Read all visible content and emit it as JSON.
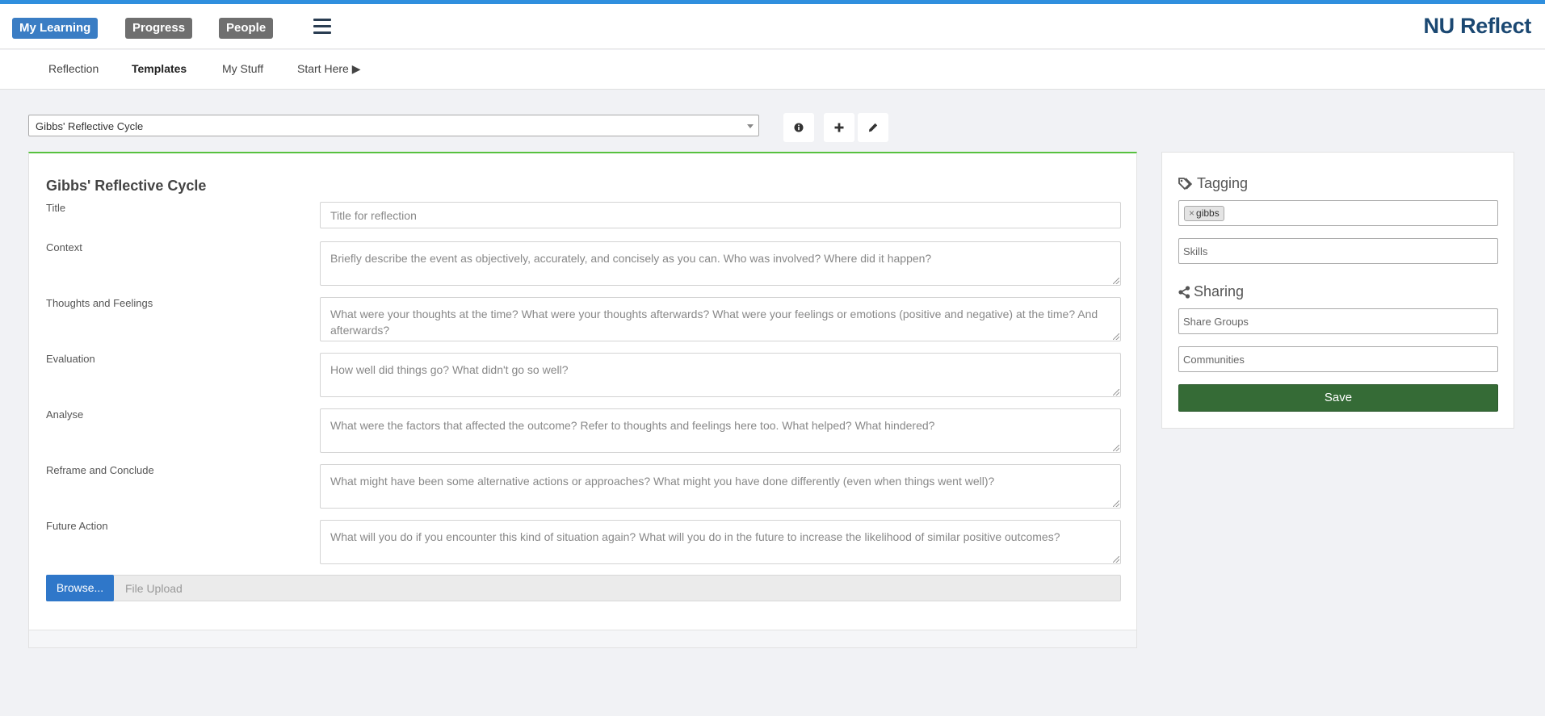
{
  "colors": {
    "top_stripe": "#2f8fde",
    "accent_blue": "#3a7dc4",
    "pill_grey": "#6f6f6f",
    "brand": "#1b4872",
    "panel_border_green": "#57c13f",
    "save_green": "#356b36",
    "browse_blue": "#2f77c9"
  },
  "header": {
    "nav": {
      "my_learning": "My Learning",
      "progress": "Progress",
      "people": "People"
    },
    "menu_icon": "hamburger-icon",
    "brand": "NU Reflect"
  },
  "subnav": {
    "items": [
      {
        "label": "Reflection"
      },
      {
        "label": "Templates",
        "active": true
      },
      {
        "label": "My Stuff"
      },
      {
        "label": "Start Here ▶"
      }
    ]
  },
  "template_selector": {
    "selected": "Gibbs' Reflective Cycle",
    "icons": [
      "info-icon",
      "plus-icon",
      "pencil-icon"
    ]
  },
  "form": {
    "title": "Gibbs' Reflective Cycle",
    "fields": [
      {
        "label": "Title",
        "placeholder": "Title for reflection"
      },
      {
        "label": "Context",
        "placeholder": "Briefly describe the event as objectively, accurately, and concisely as you can. Who was involved? Where did it happen?"
      },
      {
        "label": "Thoughts and Feelings",
        "placeholder": "What were your thoughts at the time? What were your thoughts afterwards? What were your feelings or emotions (positive and negative) at the time? And afterwards?"
      },
      {
        "label": "Evaluation",
        "placeholder": "How well did things go? What didn't go so well?"
      },
      {
        "label": "Analyse",
        "placeholder": "What were the factors that affected the outcome? Refer to thoughts and feelings here too. What helped? What hindered?"
      },
      {
        "label": "Reframe and Conclude",
        "placeholder": "What might have been some alternative actions or approaches? What might you have done differently (even when things went well)?"
      },
      {
        "label": "Future Action",
        "placeholder": "What will you do if you encounter this kind of situation again? What will you do in the future to increase the likelihood of similar positive outcomes?"
      }
    ],
    "upload": {
      "browse": "Browse...",
      "placeholder": "File Upload"
    }
  },
  "sidebar": {
    "tagging": {
      "title": "Tagging",
      "tags": [
        {
          "remove": "×",
          "label": "gibbs"
        }
      ],
      "skills_placeholder": "Skills"
    },
    "sharing": {
      "title": "Sharing",
      "groups_placeholder": "Share Groups",
      "communities_placeholder": "Communities"
    },
    "save": "Save"
  }
}
